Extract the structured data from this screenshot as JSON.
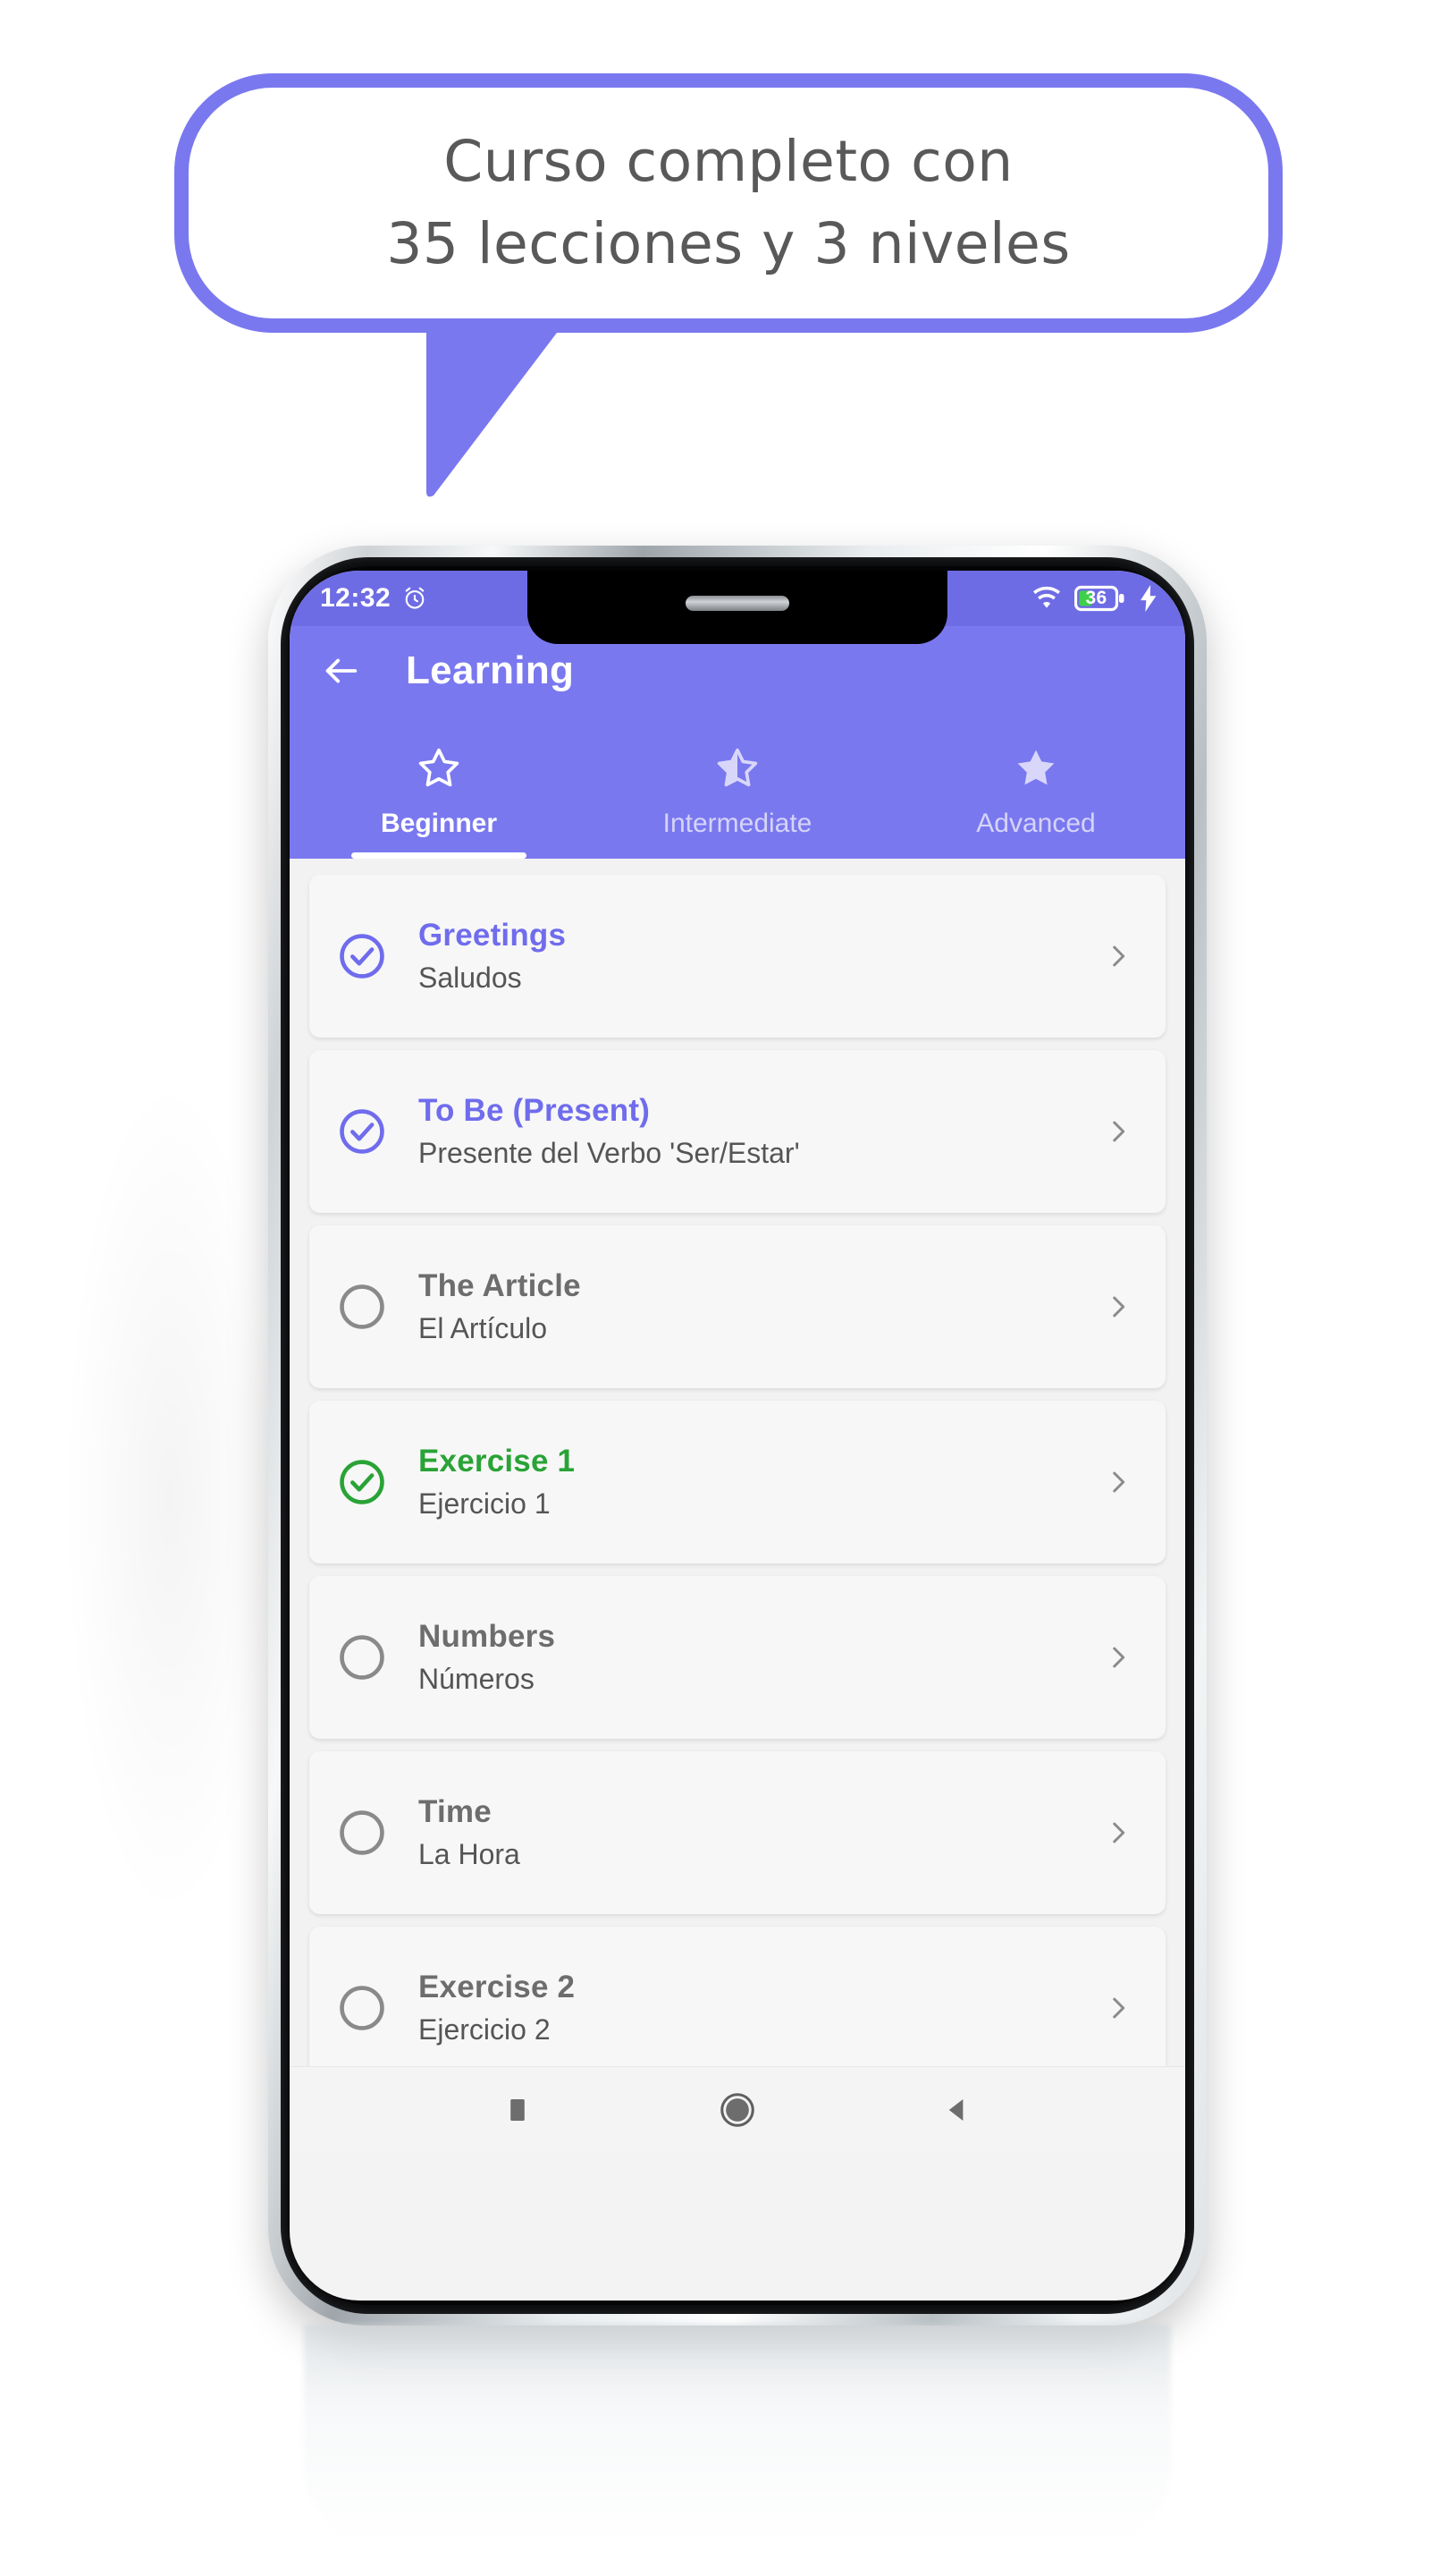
{
  "promo": {
    "bubble_line1": "Curso completo con",
    "bubble_line2": "35 lecciones y 3 niveles",
    "accent_color": "#7a78ef",
    "text_color": "#595959"
  },
  "status_bar": {
    "time": "12:32",
    "alarm_icon": "alarm-clock-icon",
    "wifi_icon": "wifi-icon",
    "battery_level": "36",
    "battery_icon": "battery-icon",
    "charging_icon": "lightning-bolt-icon",
    "background_color": "#6e6ce4"
  },
  "app_bar": {
    "back_icon": "back-arrow-icon",
    "title": "Learning",
    "background_color": "#7a78ef"
  },
  "tabs": [
    {
      "label": "Beginner",
      "icon": "star-outline-icon",
      "active": true
    },
    {
      "label": "Intermediate",
      "icon": "star-half-icon",
      "active": false
    },
    {
      "label": "Advanced",
      "icon": "star-filled-icon",
      "active": false
    }
  ],
  "lessons": [
    {
      "title": "Greetings",
      "subtitle": "Saludos",
      "status": "completed",
      "status_icon": "check-circle-icon",
      "status_color": "#6f6ced",
      "chevron_icon": "chevron-right-icon"
    },
    {
      "title": "To Be (Present)",
      "subtitle": "Presente del Verbo 'Ser/Estar'",
      "status": "completed",
      "status_icon": "check-circle-icon",
      "status_color": "#6f6ced",
      "chevron_icon": "chevron-right-icon"
    },
    {
      "title": "The Article",
      "subtitle": "El Artículo",
      "status": "pending",
      "status_icon": "empty-circle-icon",
      "status_color": "#8a8a8a",
      "chevron_icon": "chevron-right-icon"
    },
    {
      "title": "Exercise 1",
      "subtitle": "Ejercicio 1",
      "status": "exercise-completed",
      "status_icon": "check-circle-icon",
      "status_color": "#29a336",
      "chevron_icon": "chevron-right-icon"
    },
    {
      "title": "Numbers",
      "subtitle": "Números",
      "status": "pending",
      "status_icon": "empty-circle-icon",
      "status_color": "#8a8a8a",
      "chevron_icon": "chevron-right-icon"
    },
    {
      "title": "Time",
      "subtitle": "La Hora",
      "status": "pending",
      "status_icon": "empty-circle-icon",
      "status_color": "#8a8a8a",
      "chevron_icon": "chevron-right-icon"
    },
    {
      "title": "Exercise 2",
      "subtitle": "Ejercicio 2",
      "status": "pending",
      "status_icon": "empty-circle-icon",
      "status_color": "#8a8a8a",
      "chevron_icon": "chevron-right-icon"
    }
  ],
  "nav_bar": {
    "recents_icon": "square-recents-icon",
    "home_icon": "circle-home-icon",
    "back_icon": "triangle-back-icon"
  }
}
